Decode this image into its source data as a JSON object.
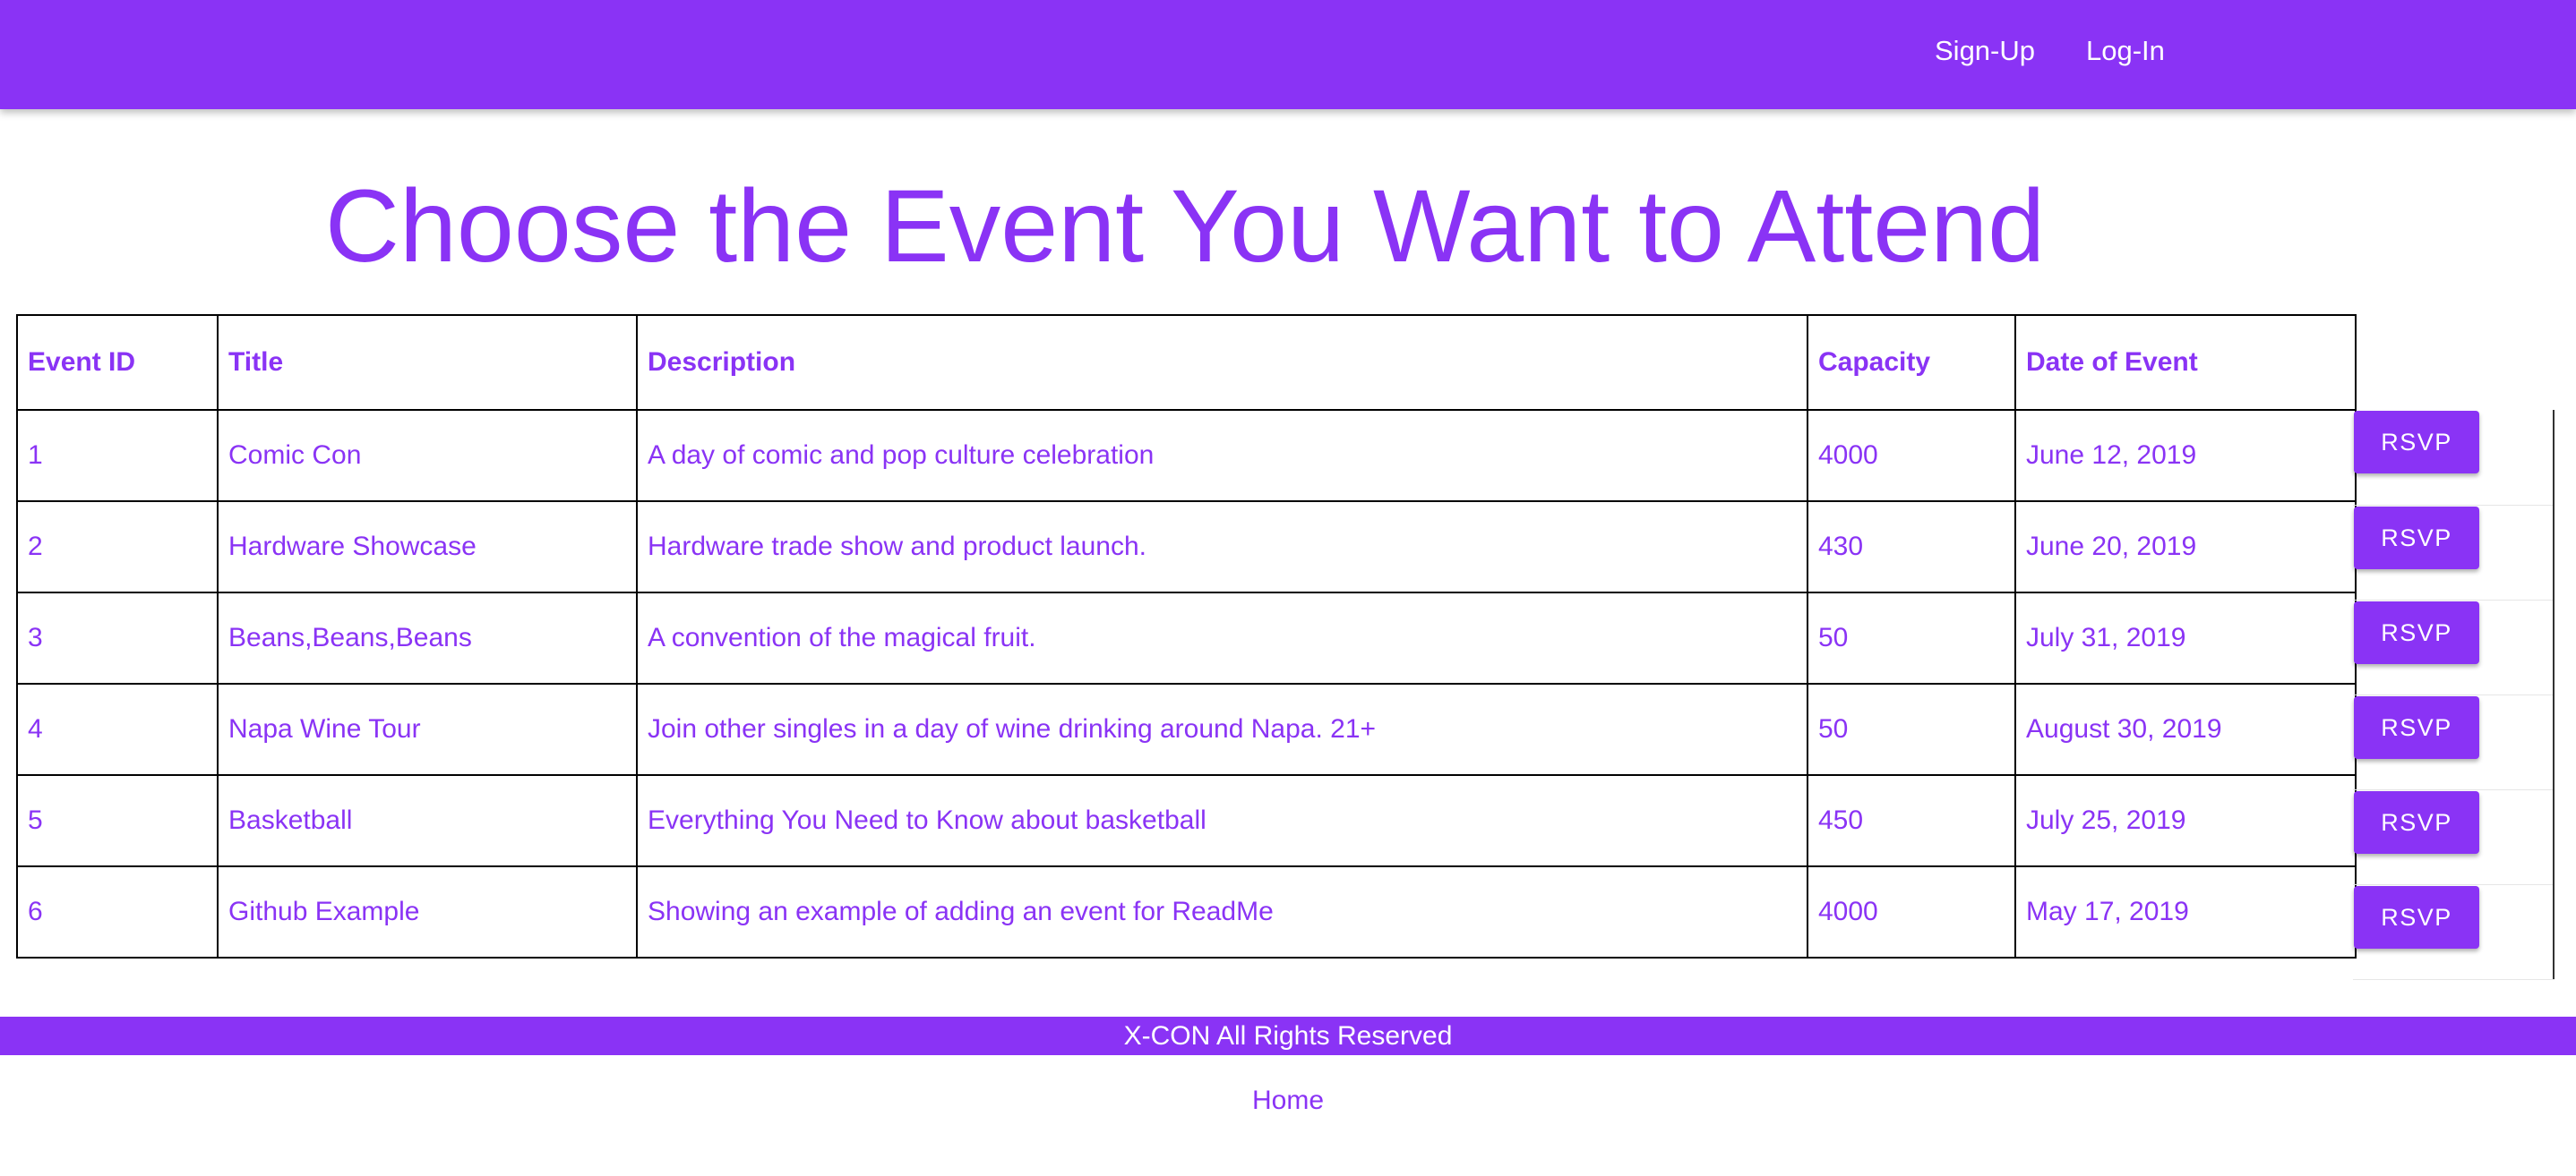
{
  "nav": {
    "signup": "Sign-Up",
    "login": "Log-In"
  },
  "page": {
    "title": "Choose the Event You Want to Attend"
  },
  "table": {
    "headers": [
      "Event ID",
      "Title",
      "Description",
      "Capacity",
      "Date of Event"
    ],
    "rows": [
      {
        "id": "1",
        "title": "Comic Con",
        "description": "A day of comic and pop culture celebration",
        "capacity": "4000",
        "date": "June 12, 2019",
        "action": "RSVP"
      },
      {
        "id": "2",
        "title": "Hardware Showcase",
        "description": "Hardware trade show and product launch.",
        "capacity": "430",
        "date": "June 20, 2019",
        "action": "RSVP"
      },
      {
        "id": "3",
        "title": "Beans,Beans,Beans",
        "description": "A convention of the magical fruit.",
        "capacity": "50",
        "date": "July 31, 2019",
        "action": "RSVP"
      },
      {
        "id": "4",
        "title": "Napa Wine Tour",
        "description": "Join other singles in a day of wine drinking around Napa. 21+",
        "capacity": "50",
        "date": "August 30, 2019",
        "action": "RSVP"
      },
      {
        "id": "5",
        "title": "Basketball",
        "description": "Everything You Need to Know about basketball",
        "capacity": "450",
        "date": "July 25, 2019",
        "action": "RSVP"
      },
      {
        "id": "6",
        "title": "Github Example",
        "description": "Showing an example of adding an event for ReadMe",
        "capacity": "4000",
        "date": "May 17, 2019",
        "action": "RSVP"
      }
    ]
  },
  "footer": {
    "copyright": "X-CON All Rights Reserved",
    "home": "Home"
  },
  "colors": {
    "accent": "#8a33f5",
    "text_on_accent": "#ffffff",
    "background": "#ffffff"
  }
}
